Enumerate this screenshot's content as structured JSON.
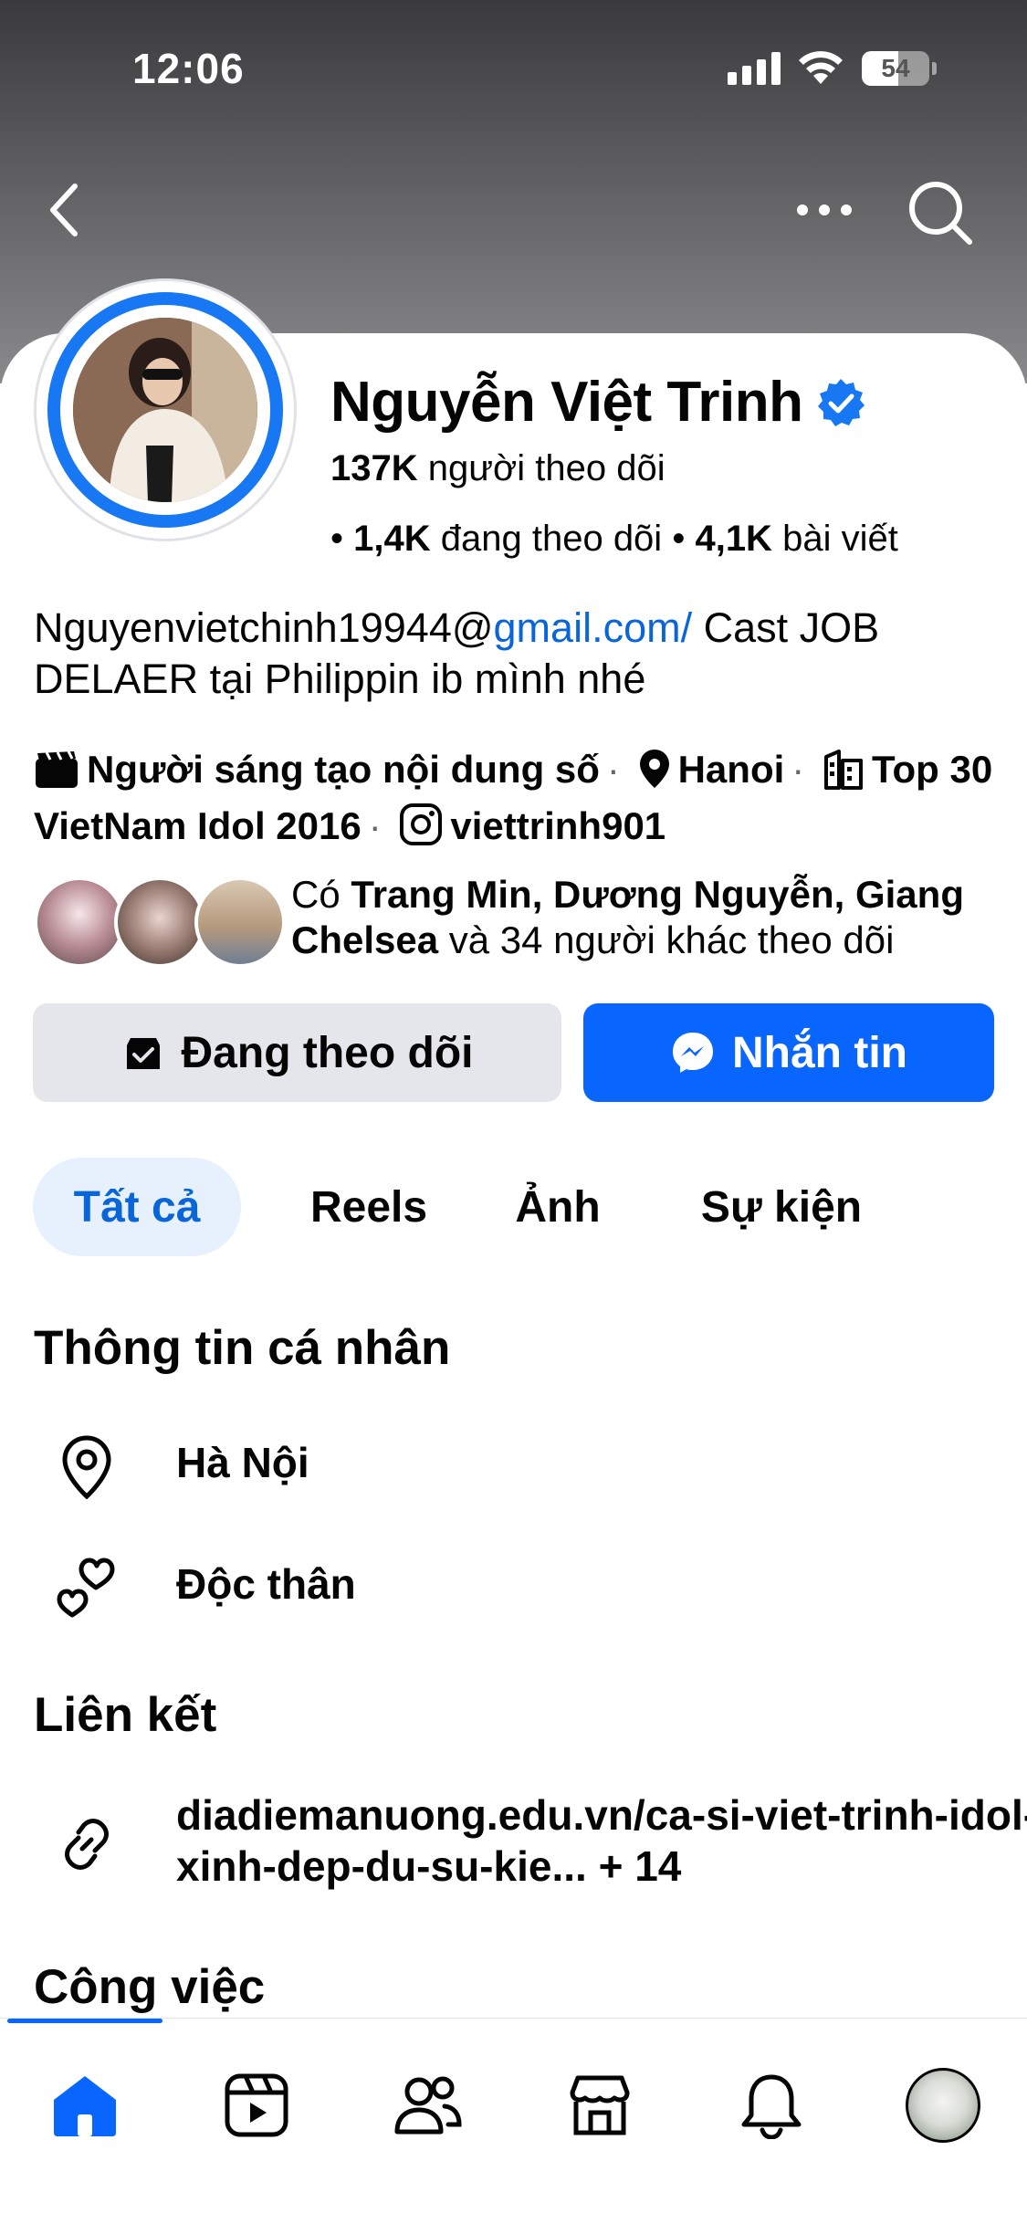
{
  "status_bar": {
    "time": "12:06",
    "battery": "54",
    "battery_percent": 54
  },
  "nav": {
    "back_icon": "chevron-left-icon",
    "more_icon": "more-dots-icon",
    "search_icon": "search-icon"
  },
  "profile": {
    "name": "Nguyễn Việt Trinh",
    "verified": true,
    "followers_count": "137K",
    "followers_label": "người theo dõi",
    "following_count": "1,4K",
    "following_label": "đang theo dõi",
    "posts_count": "4,1K",
    "posts_label": "bài viết"
  },
  "bio": {
    "prefix": "Nguyenvietchinh19944@",
    "link": "gmail.com/",
    "suffix": " Cast JOB DELAER tại Philippin  ib mình nhé"
  },
  "details": {
    "creator": "Người sáng tạo nội dung số",
    "location": "Hanoi",
    "award": "Top 30 VietNam Idol 2016",
    "instagram": "viettrinh901"
  },
  "mutual": {
    "prefix": "Có ",
    "names": "Trang Min, Dương Nguyễn, Giang Chelsea",
    "suffix": " và 34 người khác theo dõi"
  },
  "actions": {
    "following_label": "Đang theo dõi",
    "message_label": "Nhắn tin"
  },
  "tabs": [
    {
      "label": "Tất cả",
      "active": true
    },
    {
      "label": "Reels",
      "active": false
    },
    {
      "label": "Ảnh",
      "active": false
    },
    {
      "label": "Sự kiện",
      "active": false
    }
  ],
  "about": {
    "title": "Thông tin cá nhân",
    "city": "Hà Nội",
    "relationship": "Độc thân"
  },
  "links": {
    "title": "Liên kết",
    "url": "diadiemanuong.edu.vn/ca-si-viet-trinh-idol-xinh-dep-du-su-kie...",
    "more": "+ 14"
  },
  "work": {
    "title": "Công việc"
  },
  "bottom_nav": [
    {
      "name": "home-icon",
      "active": true
    },
    {
      "name": "reels-icon",
      "active": false
    },
    {
      "name": "friends-icon",
      "active": false
    },
    {
      "name": "marketplace-icon",
      "active": false
    },
    {
      "name": "bell-icon",
      "active": false
    },
    {
      "name": "profile-avatar",
      "active": false
    }
  ],
  "colors": {
    "accent": "#0866ff",
    "link": "#0a66d8",
    "tab_active_bg": "#e7f0fd",
    "button_gray": "#e4e6eb"
  }
}
